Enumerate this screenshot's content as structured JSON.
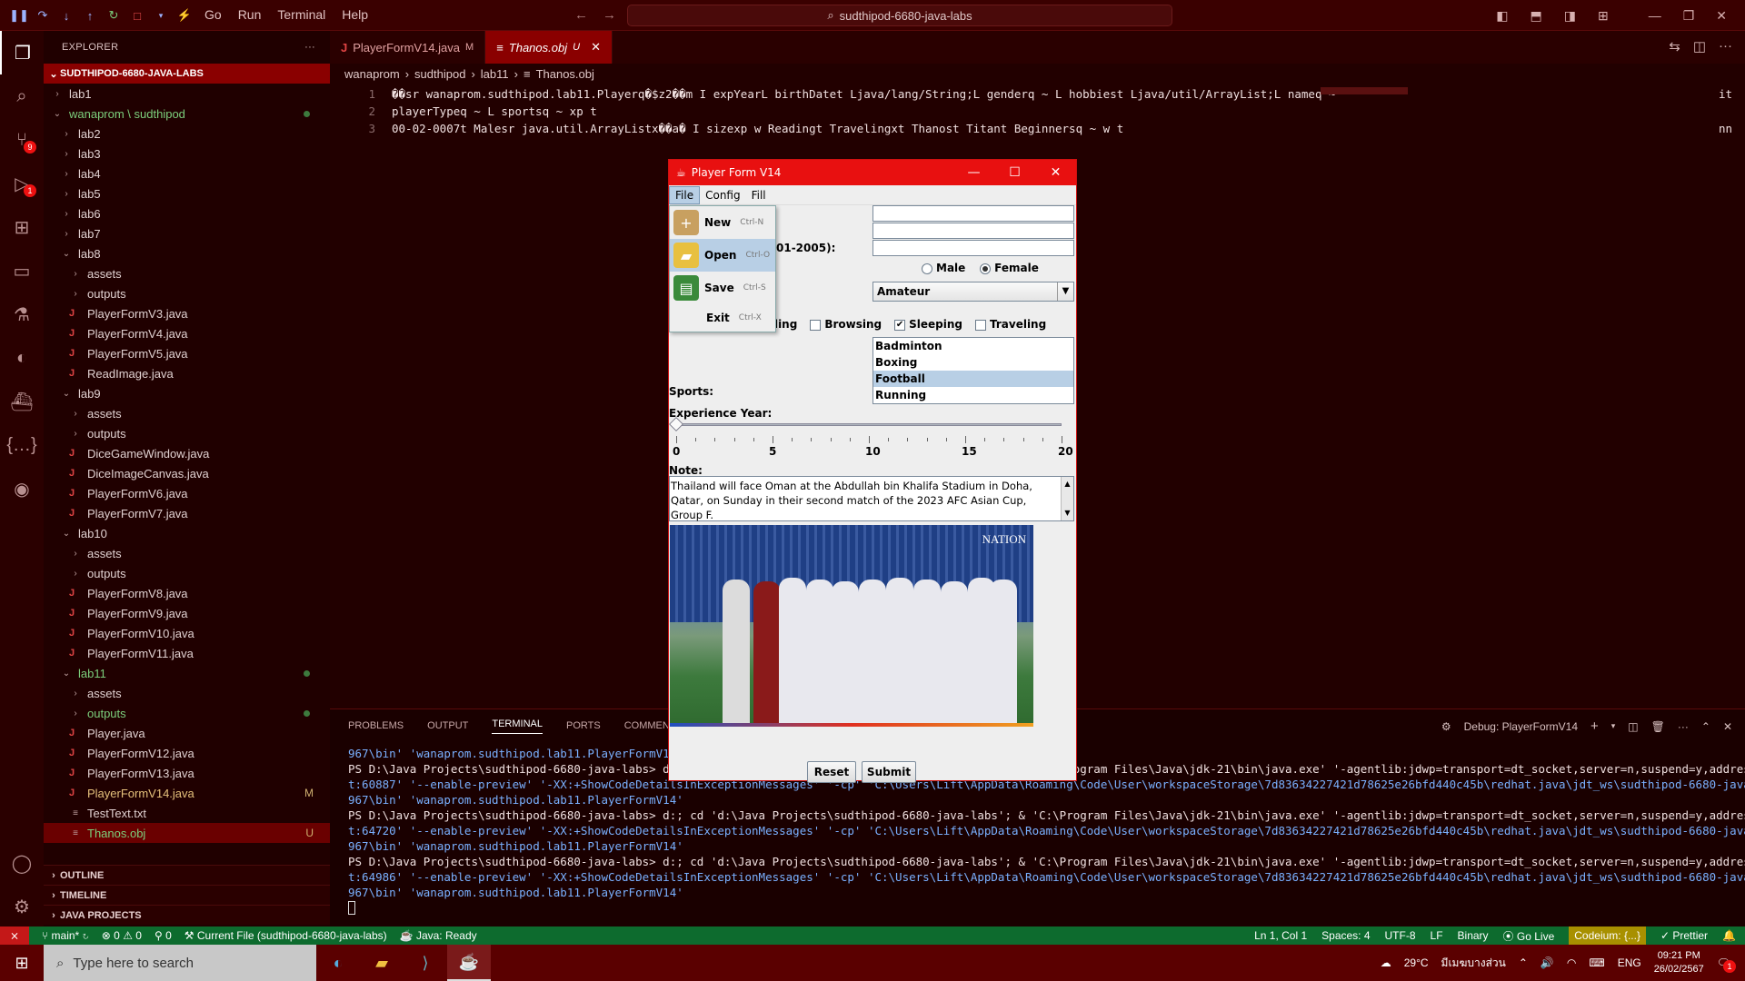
{
  "titlebar": {
    "menu": [
      "Go",
      "Run",
      "Terminal",
      "Help"
    ],
    "search": "sudthipod-6680-java-labs"
  },
  "explorer": {
    "header": "EXPLORER",
    "section": "SUDTHIPOD-6680-JAVA-LABS",
    "items": [
      {
        "label": "lab1",
        "depth": 1,
        "type": "folder",
        "open": false
      },
      {
        "label": "wanaprom \\ sudthipod",
        "depth": 1,
        "type": "folder",
        "open": true,
        "color": "green",
        "dot": true
      },
      {
        "label": "lab2",
        "depth": 2,
        "type": "folder",
        "open": false
      },
      {
        "label": "lab3",
        "depth": 2,
        "type": "folder",
        "open": false
      },
      {
        "label": "lab4",
        "depth": 2,
        "type": "folder",
        "open": false
      },
      {
        "label": "lab5",
        "depth": 2,
        "type": "folder",
        "open": false
      },
      {
        "label": "lab6",
        "depth": 2,
        "type": "folder",
        "open": false
      },
      {
        "label": "lab7",
        "depth": 2,
        "type": "folder",
        "open": false
      },
      {
        "label": "lab8",
        "depth": 2,
        "type": "folder",
        "open": true
      },
      {
        "label": "assets",
        "depth": 3,
        "type": "folder",
        "open": false
      },
      {
        "label": "outputs",
        "depth": 3,
        "type": "folder",
        "open": false
      },
      {
        "label": "PlayerFormV3.java",
        "depth": 3,
        "type": "java"
      },
      {
        "label": "PlayerFormV4.java",
        "depth": 3,
        "type": "java"
      },
      {
        "label": "PlayerFormV5.java",
        "depth": 3,
        "type": "java"
      },
      {
        "label": "ReadImage.java",
        "depth": 3,
        "type": "java"
      },
      {
        "label": "lab9",
        "depth": 2,
        "type": "folder",
        "open": true
      },
      {
        "label": "assets",
        "depth": 3,
        "type": "folder",
        "open": false
      },
      {
        "label": "outputs",
        "depth": 3,
        "type": "folder",
        "open": false
      },
      {
        "label": "DiceGameWindow.java",
        "depth": 3,
        "type": "java"
      },
      {
        "label": "DiceImageCanvas.java",
        "depth": 3,
        "type": "java"
      },
      {
        "label": "PlayerFormV6.java",
        "depth": 3,
        "type": "java"
      },
      {
        "label": "PlayerFormV7.java",
        "depth": 3,
        "type": "java"
      },
      {
        "label": "lab10",
        "depth": 2,
        "type": "folder",
        "open": true
      },
      {
        "label": "assets",
        "depth": 3,
        "type": "folder",
        "open": false
      },
      {
        "label": "outputs",
        "depth": 3,
        "type": "folder",
        "open": false
      },
      {
        "label": "PlayerFormV8.java",
        "depth": 3,
        "type": "java"
      },
      {
        "label": "PlayerFormV9.java",
        "depth": 3,
        "type": "java"
      },
      {
        "label": "PlayerFormV10.java",
        "depth": 3,
        "type": "java"
      },
      {
        "label": "PlayerFormV11.java",
        "depth": 3,
        "type": "java"
      },
      {
        "label": "lab11",
        "depth": 2,
        "type": "folder",
        "open": true,
        "color": "green",
        "dot": true
      },
      {
        "label": "assets",
        "depth": 3,
        "type": "folder",
        "open": false
      },
      {
        "label": "outputs",
        "depth": 3,
        "type": "folder",
        "open": false,
        "color": "green",
        "dot": true
      },
      {
        "label": "Player.java",
        "depth": 3,
        "type": "java"
      },
      {
        "label": "PlayerFormV12.java",
        "depth": 3,
        "type": "java"
      },
      {
        "label": "PlayerFormV13.java",
        "depth": 3,
        "type": "java"
      },
      {
        "label": "PlayerFormV14.java",
        "depth": 3,
        "type": "java",
        "color": "yellowish",
        "mark": "M"
      },
      {
        "label": "TestText.txt",
        "depth": 3,
        "type": "txt"
      },
      {
        "label": "Thanos.obj",
        "depth": 3,
        "type": "obj",
        "color": "green",
        "mark": "U",
        "selected": true
      }
    ],
    "bottom_sections": [
      "OUTLINE",
      "TIMELINE",
      "JAVA PROJECTS"
    ]
  },
  "editor": {
    "tabs": [
      {
        "label": "PlayerFormV14.java",
        "tag": "M",
        "active": false
      },
      {
        "label": "Thanos.obj",
        "tag": "U",
        "active": true
      }
    ],
    "breadcrumb": [
      "wanaprom",
      "sudthipod",
      "lab11",
      "Thanos.obj"
    ],
    "lines": [
      {
        "num": "1",
        "text": "��sr wanaprom.sudthipod.lab11.Playerq�$z2��m I expYearL  birthDatet Ljava/lang/String;L genderq ~ L hobbiest Ljava/util/ArrayList;L nameq ~"
      },
      {
        "num": "2",
        "text": "playerTypeq ~ L sportsq ~ xp t"
      },
      {
        "num": "3",
        "text": "00-02-0007t Malesr java.util.ArrayListx��a� I sizexp w Readingt  Travelingxt Thanost Titant Beginnersq ~ w t"
      }
    ],
    "line1_right": "it",
    "line3_right": "nn"
  },
  "panel": {
    "tabs": [
      "PROBLEMS",
      "OUTPUT",
      "TERMINAL",
      "PORTS",
      "COMMENTS"
    ],
    "active_tab": "TERMINAL",
    "debug_label": "Debug: PlayerFormV14",
    "terminal_lines": [
      "967\\bin' 'wanaprom.sudthipod.lab11.PlayerFormV14'",
      "PS D:\\Java Projects\\sudthipod-6680-java-labs> d:; cd 'd:\\Java Projects\\sudthipod-6680-java-labs'; & 'C:\\Program Files\\Java\\jdk-21\\bin\\java.exe' '-agentlib:jdwp=transport=dt_socket,server=n,suspend=y,address=localhos",
      "t:60887' '--enable-preview' '-XX:+ShowCodeDetailsInExceptionMessages' '-cp' 'C:\\Users\\Lift\\AppData\\Roaming\\Code\\User\\workspaceStorage\\7d83634227421d78625e26bfd440c45b\\redhat.java\\jdt_ws\\sudthipod-6680-java-labs_94bfb",
      "967\\bin' 'wanaprom.sudthipod.lab11.PlayerFormV14'",
      "PS D:\\Java Projects\\sudthipod-6680-java-labs> d:; cd 'd:\\Java Projects\\sudthipod-6680-java-labs'; & 'C:\\Program Files\\Java\\jdk-21\\bin\\java.exe' '-agentlib:jdwp=transport=dt_socket,server=n,suspend=y,address=localhos",
      "t:64720' '--enable-preview' '-XX:+ShowCodeDetailsInExceptionMessages' '-cp' 'C:\\Users\\Lift\\AppData\\Roaming\\Code\\User\\workspaceStorage\\7d83634227421d78625e26bfd440c45b\\redhat.java\\jdt_ws\\sudthipod-6680-java-labs_94bfb",
      "967\\bin' 'wanaprom.sudthipod.lab11.PlayerFormV14'",
      "PS D:\\Java Projects\\sudthipod-6680-java-labs> d:; cd 'd:\\Java Projects\\sudthipod-6680-java-labs'; & 'C:\\Program Files\\Java\\jdk-21\\bin\\java.exe' '-agentlib:jdwp=transport=dt_socket,server=n,suspend=y,address=localhos",
      "t:64986' '--enable-preview' '-XX:+ShowCodeDetailsInExceptionMessages' '-cp' 'C:\\Users\\Lift\\AppData\\Roaming\\Code\\User\\workspaceStorage\\7d83634227421d78625e26bfd440c45b\\redhat.java\\jdt_ws\\sudthipod-6680-java-labs_94bfb",
      "967\\bin' 'wanaprom.sudthipod.lab11.PlayerFormV14'"
    ]
  },
  "statusbar": {
    "branch": "main*",
    "errors": "0",
    "warnings": "0",
    "ports": "0",
    "current_file": "Current File (sudthipod-6680-java-labs)",
    "java": "Java: Ready",
    "position": "Ln 1, Col 1",
    "spaces": "Spaces: 4",
    "encoding": "UTF-8",
    "eol": "LF",
    "lang": "Binary",
    "golive": "Go Live",
    "codeium": "Codeium: {...}",
    "prettier": "Prettier"
  },
  "taskbar": {
    "search_placeholder": "Type here to search",
    "weather": "29°C",
    "weather_text": "มีเมฆบางส่วน",
    "lang": "ENG",
    "time": "09:21 PM",
    "date": "26/02/2567",
    "notif": "1"
  },
  "player_form": {
    "title": "Player Form V14",
    "menu": [
      "File",
      "Config",
      "Fill"
    ],
    "file_menu": [
      {
        "label": "New",
        "accel": "Ctrl-N",
        "color": "#c8a060",
        "glyph": "+"
      },
      {
        "label": "Open",
        "accel": "Ctrl-O",
        "color": "#e8c040",
        "glyph": "▰"
      },
      {
        "label": "Save",
        "accel": "Ctrl-S",
        "color": "#3a8a3a",
        "glyph": "▤"
      },
      {
        "label": "Exit",
        "accel": "Ctrl-X"
      }
    ],
    "birth_label_partial": "01-2005):",
    "gender": {
      "male": "Male",
      "female": "Female",
      "selected": "Female"
    },
    "player_type": "Amateur",
    "hobbies": [
      {
        "label": "Reading",
        "checked": false
      },
      {
        "label": "Browsing",
        "checked": false
      },
      {
        "label": "Sleeping",
        "checked": true
      },
      {
        "label": "Traveling",
        "checked": false
      }
    ],
    "sports_label": "Sports:",
    "sports": [
      {
        "label": "Badminton",
        "selected": false
      },
      {
        "label": "Boxing",
        "selected": false
      },
      {
        "label": "Football",
        "selected": true
      },
      {
        "label": "Running",
        "selected": false
      }
    ],
    "experience_label": "Experience Year:",
    "slider_ticks": [
      "0",
      "5",
      "10",
      "15",
      "20"
    ],
    "slider_value": 0,
    "note_label": "Note:",
    "note": "Thailand will face Oman at the Abdullah bin Khalifa Stadium in Doha, Qatar, on Sunday in their second match of the 2023 AFC Asian Cup, Group F.",
    "image_logo": "NATION",
    "reset": "Reset",
    "submit": "Submit"
  }
}
